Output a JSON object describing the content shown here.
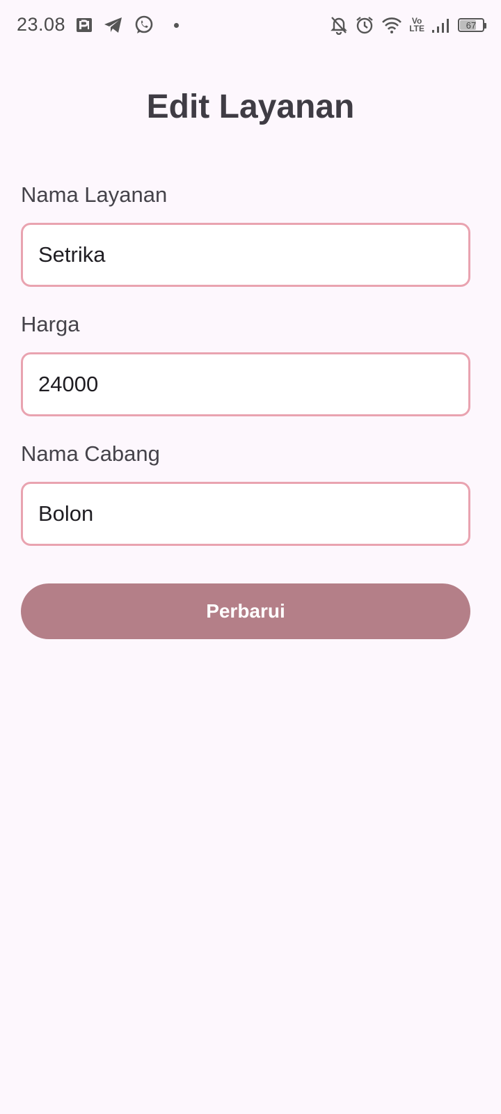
{
  "status_bar": {
    "time": "23.08",
    "battery_level": "67",
    "volte_top": "Vo",
    "volte_bottom": "LTE",
    "left_icons": [
      "parking-app-icon",
      "telegram-icon",
      "whatsapp-icon",
      "notification-dot"
    ],
    "right_icons": [
      "bell-off-icon",
      "alarm-icon",
      "wifi-icon",
      "volte-icon",
      "signal-icon",
      "battery-icon"
    ]
  },
  "page": {
    "title": "Edit Layanan"
  },
  "form": {
    "service_name": {
      "label": "Nama Layanan",
      "value": "Setrika"
    },
    "price": {
      "label": "Harga",
      "value": "24000"
    },
    "branch_name": {
      "label": "Nama Cabang",
      "value": "Bolon"
    },
    "submit_label": "Perbarui"
  },
  "colors": {
    "background": "#fdf7fd",
    "field_border": "#e9a3b0",
    "button": "#b47f88",
    "title": "#3f3c44"
  }
}
